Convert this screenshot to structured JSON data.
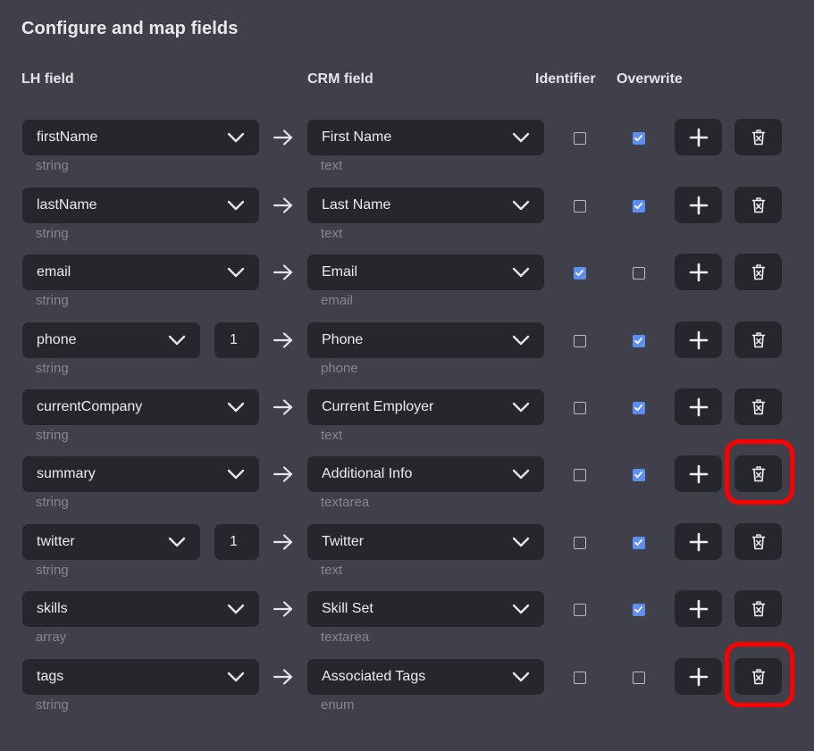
{
  "title": "Configure and map fields",
  "headers": {
    "lh_field": "LH field",
    "crm_field": "CRM field",
    "identifier": "Identifier",
    "overwrite": "Overwrite"
  },
  "rows": [
    {
      "lh": "firstName",
      "lh_type": "string",
      "num": null,
      "crm": "First Name",
      "crm_type": "text",
      "identifier": false,
      "overwrite": true,
      "highlight": false
    },
    {
      "lh": "lastName",
      "lh_type": "string",
      "num": null,
      "crm": "Last Name",
      "crm_type": "text",
      "identifier": false,
      "overwrite": true,
      "highlight": false
    },
    {
      "lh": "email",
      "lh_type": "string",
      "num": null,
      "crm": "Email",
      "crm_type": "email",
      "identifier": true,
      "overwrite": false,
      "highlight": false
    },
    {
      "lh": "phone",
      "lh_type": "string",
      "num": "1",
      "crm": "Phone",
      "crm_type": "phone",
      "identifier": false,
      "overwrite": true,
      "highlight": false
    },
    {
      "lh": "currentCompany",
      "lh_type": "string",
      "num": null,
      "crm": "Current Employer",
      "crm_type": "text",
      "identifier": false,
      "overwrite": true,
      "highlight": false
    },
    {
      "lh": "summary",
      "lh_type": "string",
      "num": null,
      "crm": "Additional Info",
      "crm_type": "textarea",
      "identifier": false,
      "overwrite": true,
      "highlight": true
    },
    {
      "lh": "twitter",
      "lh_type": "string",
      "num": "1",
      "crm": "Twitter",
      "crm_type": "text",
      "identifier": false,
      "overwrite": true,
      "highlight": false
    },
    {
      "lh": "skills",
      "lh_type": "array",
      "num": null,
      "crm": "Skill Set",
      "crm_type": "textarea",
      "identifier": false,
      "overwrite": true,
      "highlight": false
    },
    {
      "lh": "tags",
      "lh_type": "string",
      "num": null,
      "crm": "Associated Tags",
      "crm_type": "enum",
      "identifier": false,
      "overwrite": false,
      "highlight": true
    }
  ],
  "icons": {
    "chevron": "chevron-down-icon",
    "arrow": "arrow-right-icon",
    "check": "checkmark-icon",
    "add": "plus-icon",
    "delete": "trash-icon"
  },
  "colors": {
    "background": "#3f4049",
    "control": "#26272d",
    "checkbox_on": "#5e8ff0",
    "highlight": "#ff0000",
    "muted_text": "#85868e"
  }
}
